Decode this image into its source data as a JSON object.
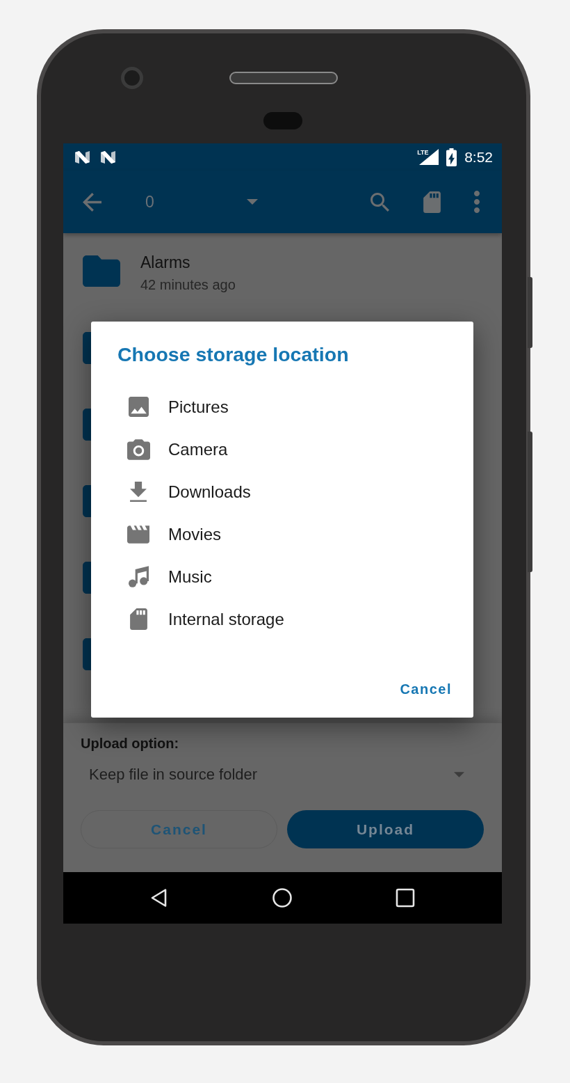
{
  "status_bar": {
    "network_type": "LTE",
    "time": "8:52"
  },
  "toolbar": {
    "title": "0"
  },
  "files": [
    {
      "name": "Alarms",
      "modified": "42 minutes ago"
    }
  ],
  "storage_dialog": {
    "title": "Choose storage location",
    "locations": [
      {
        "kind": "pictures",
        "label": "Pictures"
      },
      {
        "kind": "camera",
        "label": "Camera"
      },
      {
        "kind": "downloads",
        "label": "Downloads"
      },
      {
        "kind": "movies",
        "label": "Movies"
      },
      {
        "kind": "music",
        "label": "Music"
      },
      {
        "kind": "internal",
        "label": "Internal storage"
      }
    ],
    "cancel_button": "Cancel"
  },
  "upload_panel": {
    "label": "Upload option:",
    "option": "Keep file in source folder",
    "buttons": [
      {
        "kind": "outlined",
        "label": "Cancel"
      },
      {
        "kind": "filled",
        "label": "Upload"
      }
    ]
  }
}
